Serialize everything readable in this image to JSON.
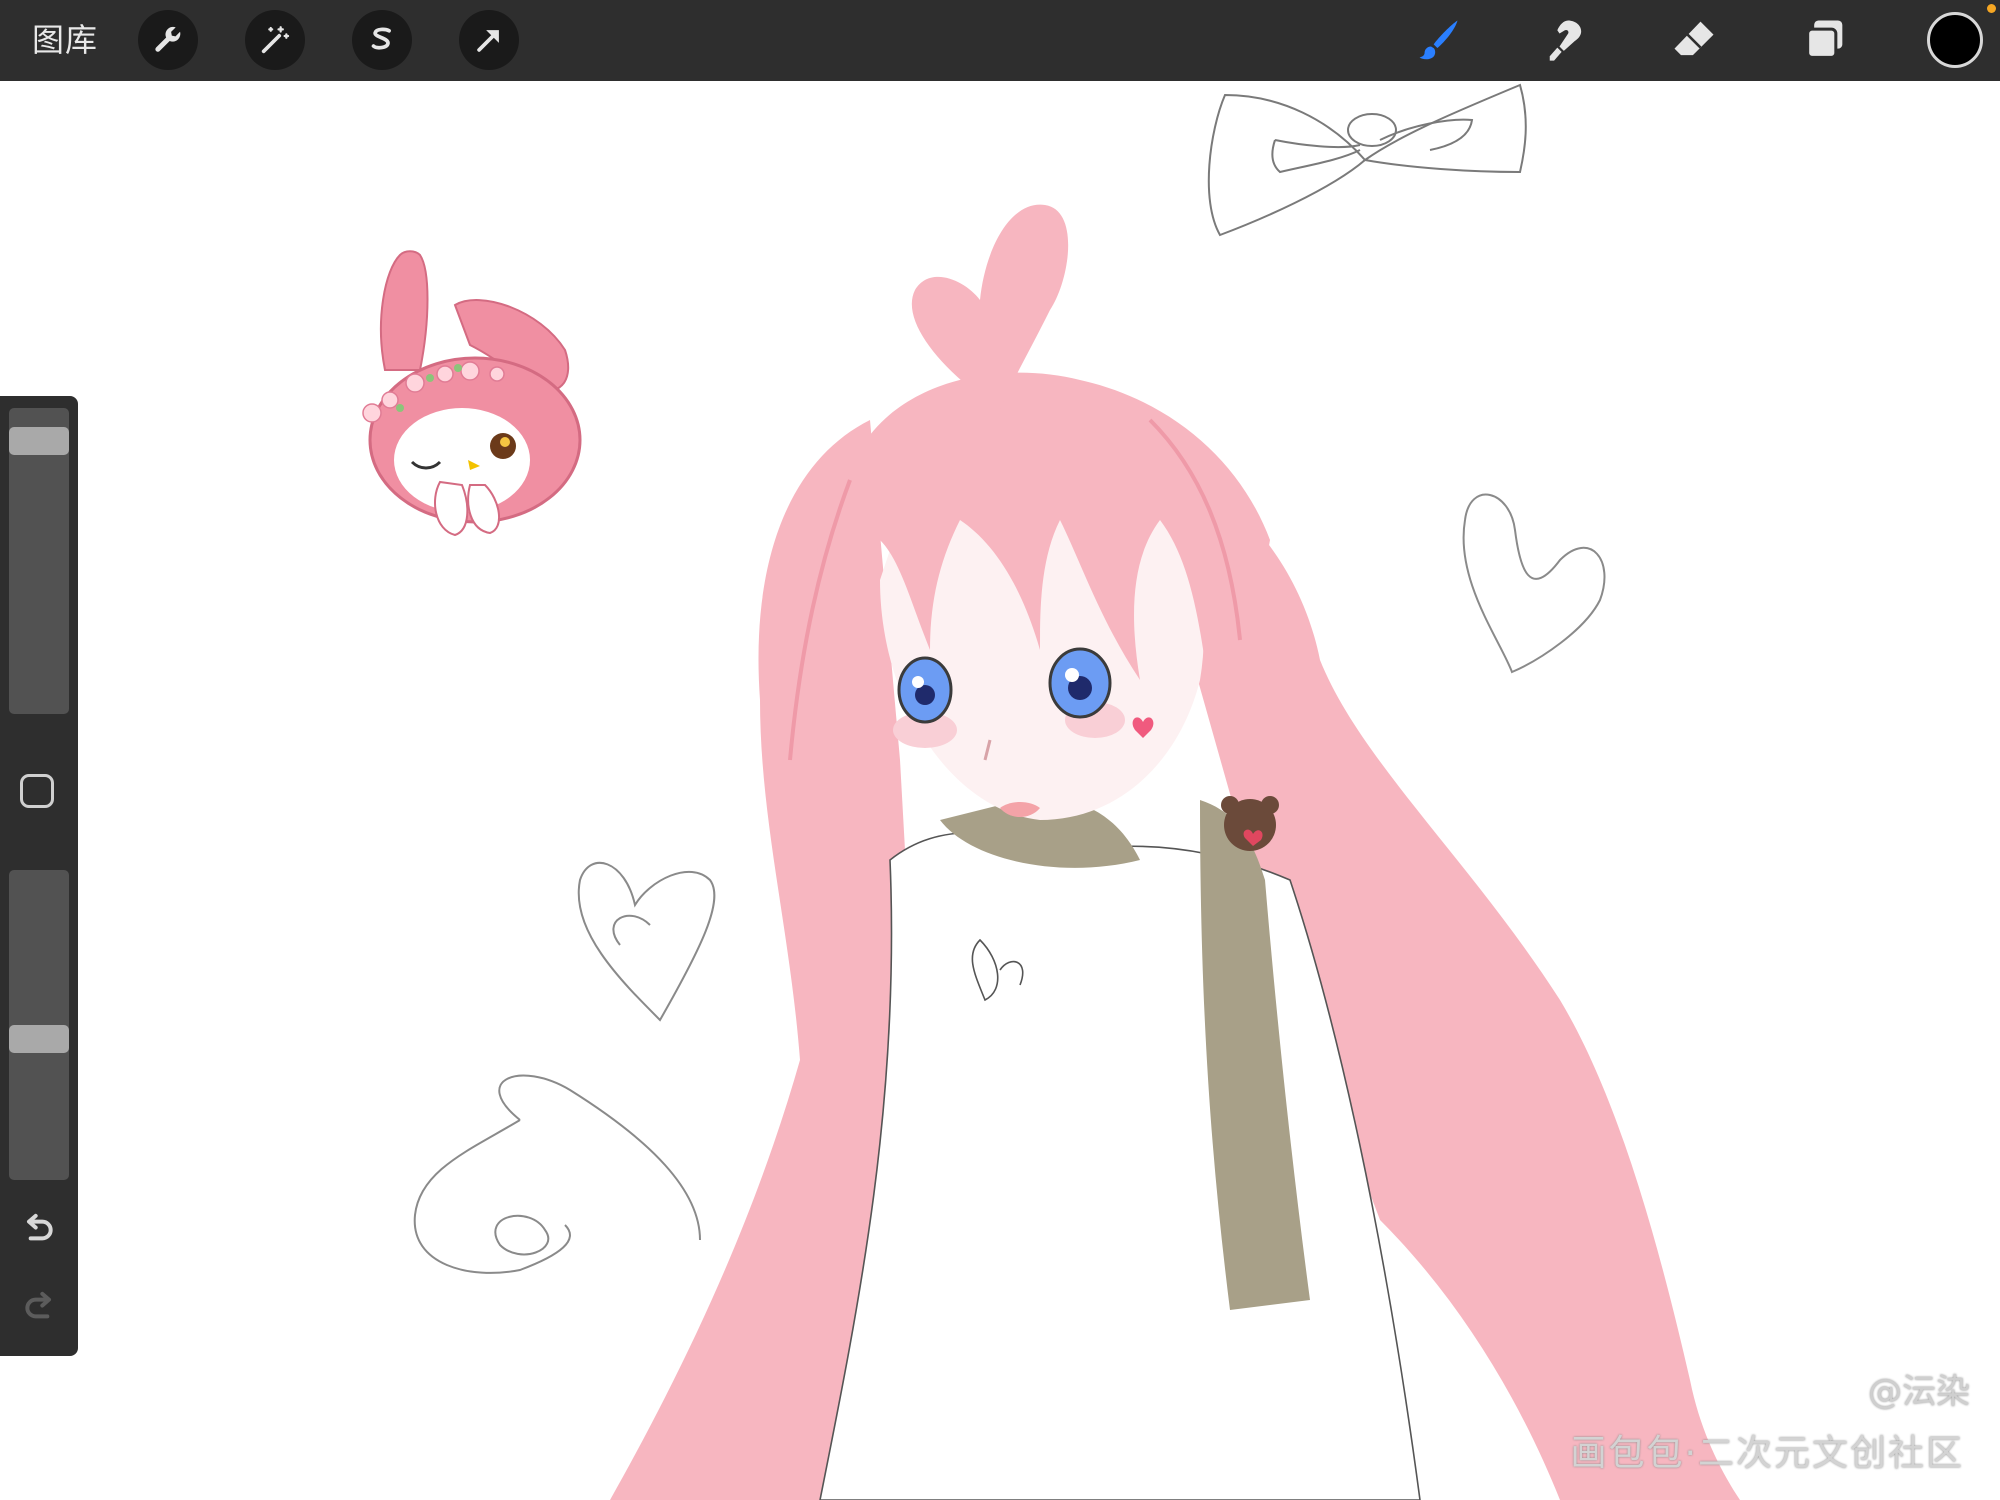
{
  "toolbar": {
    "gallery_label": "图库",
    "left_tools": [
      {
        "name": "wrench-icon",
        "label": "actions"
      },
      {
        "name": "magic-wand-icon",
        "label": "adjustments"
      },
      {
        "name": "selection-s-icon",
        "label": "selection"
      },
      {
        "name": "transform-arrow-icon",
        "label": "transform"
      }
    ],
    "right_tools": [
      {
        "name": "brush-icon",
        "active": true
      },
      {
        "name": "smudge-icon",
        "active": false
      },
      {
        "name": "eraser-icon",
        "active": false
      },
      {
        "name": "layers-icon",
        "active": false
      }
    ],
    "current_color": "#000000",
    "accent_color": "#2a7fff",
    "status_dot_color": "#f5a623"
  },
  "sidebar": {
    "brush_size_level": 0.93,
    "opacity_level": 0.45,
    "icons": [
      "modify-square-icon",
      "undo-icon",
      "redo-icon"
    ]
  },
  "canvas": {
    "watermark_handle": "@沄染",
    "watermark_site": "画包包·二次元文创社区"
  }
}
